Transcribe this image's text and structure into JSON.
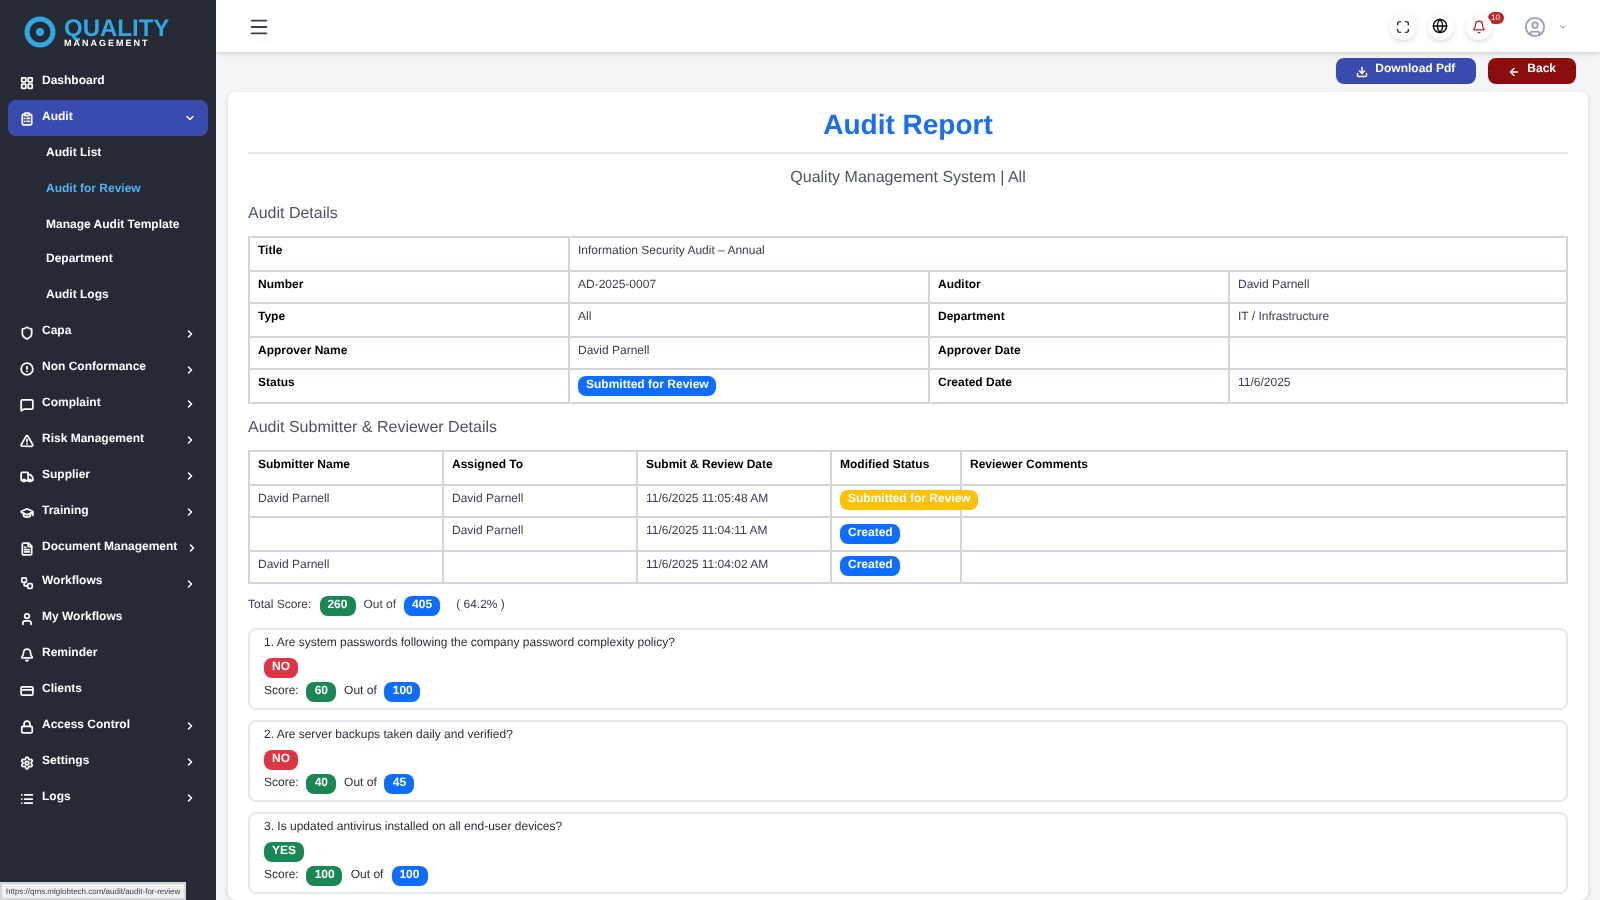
{
  "brand": {
    "name": "QUALITY",
    "tagline": "MANAGEMENT"
  },
  "sidebar": {
    "items": [
      {
        "label": "Dashboard",
        "selected": false
      },
      {
        "label": "Audit",
        "selected": true,
        "expanded": true,
        "children": [
          {
            "label": "Audit List",
            "selected": false
          },
          {
            "label": "Audit for Review",
            "selected": true
          },
          {
            "label": "Manage Audit Template",
            "selected": false
          },
          {
            "label": "Department",
            "selected": false
          },
          {
            "label": "Audit Logs",
            "selected": false
          }
        ]
      },
      {
        "label": "Capa",
        "selected": false,
        "expanded": false
      },
      {
        "label": "Non Conformance",
        "selected": false,
        "expanded": false
      },
      {
        "label": "Complaint",
        "selected": false,
        "expanded": false
      },
      {
        "label": "Risk Management",
        "selected": false,
        "expanded": false
      },
      {
        "label": "Supplier",
        "selected": false,
        "expanded": false
      },
      {
        "label": "Training",
        "selected": false,
        "expanded": false
      },
      {
        "label": "Document Management",
        "selected": false,
        "expanded": false
      },
      {
        "label": "Workflows",
        "selected": false,
        "expanded": false
      },
      {
        "label": "My Workflows",
        "selected": false
      },
      {
        "label": "Reminder",
        "selected": false
      },
      {
        "label": "Clients",
        "selected": false
      },
      {
        "label": "Access Control",
        "selected": false,
        "expanded": false
      },
      {
        "label": "Settings",
        "selected": false,
        "expanded": false
      },
      {
        "label": "Logs",
        "selected": false,
        "expanded": false
      }
    ]
  },
  "topbar": {
    "notification_count": "10"
  },
  "actions": [
    {
      "label": "Download Pdf",
      "kind": "download"
    },
    {
      "label": "Back",
      "kind": "back"
    }
  ],
  "report": {
    "title": "Audit Report",
    "subtitle": "Quality Management System | All",
    "details_heading": "Audit Details",
    "details": [
      [
        {
          "label": "Title",
          "value": "Information Security Audit – Annual"
        }
      ],
      [
        {
          "label": "Number",
          "value": "AD-2025-0007"
        },
        {
          "label": "Auditor",
          "value": "David Parnell"
        }
      ],
      [
        {
          "label": "Type",
          "value": "All"
        },
        {
          "label": "Department",
          "value": "IT / Infrastructure"
        }
      ],
      [
        {
          "label": "Approver Name",
          "value": "David Parnell"
        },
        {
          "label": "Approver Date"
        }
      ],
      [
        {
          "label": "Status",
          "value": "Submitted for Review",
          "kind": "badge",
          "color": "#0d6efd"
        },
        {
          "label": "Created Date",
          "value": "11/6/2025"
        }
      ]
    ],
    "reviewer_heading": "Audit Submitter & Reviewer Details",
    "reviewer_columns": [
      "Submitter Name",
      "Assigned To",
      "Submit & Review Date",
      "Modified Status",
      "Reviewer Comments"
    ],
    "reviewer_rows": [
      {
        "submitter": "David Parnell",
        "assigned": "David Parnell",
        "date": "11/6/2025 11:05:48 AM",
        "status": "Submitted for Review",
        "color": "#ffc107"
      },
      {
        "assigned": "David Parnell",
        "date": "11/6/2025 11:04:11 AM",
        "status": "Created",
        "color": "#0d6efd"
      },
      {
        "submitter": "David Parnell",
        "date": "11/6/2025 11:04:02 AM",
        "status": "Created",
        "color": "#0d6efd"
      }
    ],
    "total": {
      "label": "Total Score:",
      "score": "260",
      "out_of_label": "Out of",
      "max": "405",
      "percent": "( 64.2% )"
    },
    "questions": [
      {
        "text": "1. Are system passwords following the company password complexity policy?",
        "answer": "NO",
        "color": "#dc3545",
        "score_label": "Score:",
        "score": "60",
        "out_of_label": "Out of",
        "max": "100"
      },
      {
        "text": "2. Are server backups taken daily and verified?",
        "answer": "NO",
        "color": "#dc3545",
        "score_label": "Score:",
        "score": "40",
        "out_of_label": "Out of",
        "max": "45"
      },
      {
        "text": "3. Is updated antivirus installed on all end-user devices?",
        "answer": "YES",
        "color": "#198754",
        "score_label": "Score:",
        "score": "100",
        "out_of_label": "Out of",
        "max": "100"
      }
    ]
  },
  "status_url": "https://qms.mlglobtech.com/audit/audit-for-review"
}
